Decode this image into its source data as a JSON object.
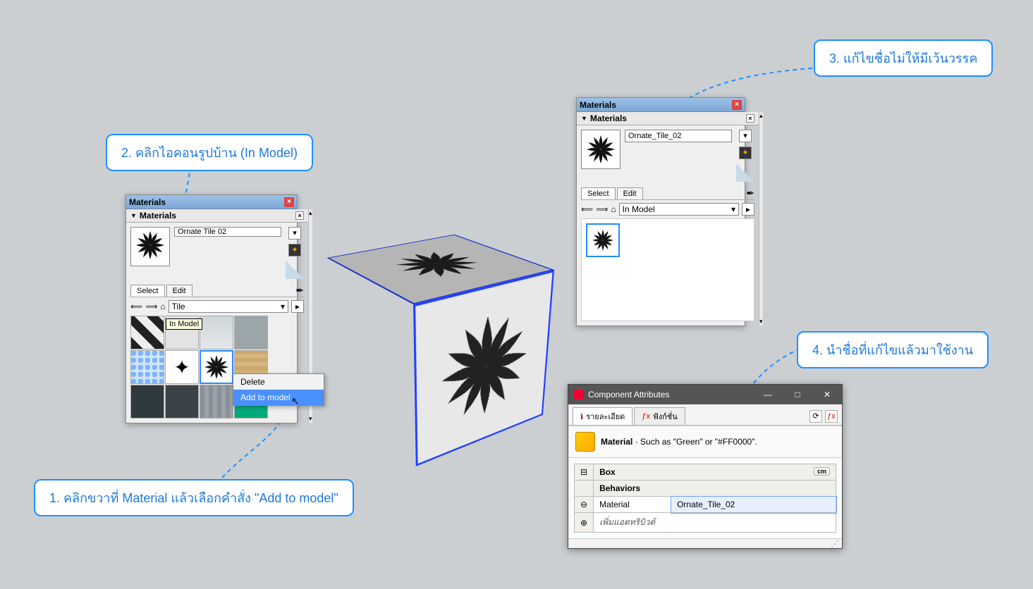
{
  "callouts": {
    "c1": "1. คลิกขวาที่ Material แล้วเลือกคำสั่ง \"Add to model\"",
    "c2": "2. คลิกไอคอนรูปบ้าน (In Model)",
    "c3": "3. แก้ไขชื่อไม่ให้มีเว้นวรรค",
    "c4": "4. นำชื่อที่แก้ไขแล้วมาใช้งาน"
  },
  "panel_left": {
    "title": "Materials",
    "sub": "Materials",
    "name_value": "Ornate Tile 02",
    "tab_select": "Select",
    "tab_edit": "Edit",
    "lib_dropdown": "Tile",
    "tooltip": "In Model",
    "ctx": {
      "delete": "Delete",
      "add": "Add to model"
    }
  },
  "panel_right": {
    "title": "Materials",
    "sub": "Materials",
    "name_value": "Ornate_Tile_02",
    "tab_select": "Select",
    "tab_edit": "Edit",
    "lib_dropdown": "In Model"
  },
  "comp": {
    "title": "Component Attributes",
    "tab1": "รายละเอียด",
    "tab2": "ฟังก์ชั่น",
    "desc_bold": "Material",
    "desc_rest": " · Such as \"Green\" or \"#FF0000\".",
    "grp_head": "Box",
    "unit": "cm",
    "sect": "Behaviors",
    "row_material": "Material",
    "row_material_val": "Ornate_Tile_02",
    "row_add": "เพิ่มแอตทริบิวต์"
  }
}
